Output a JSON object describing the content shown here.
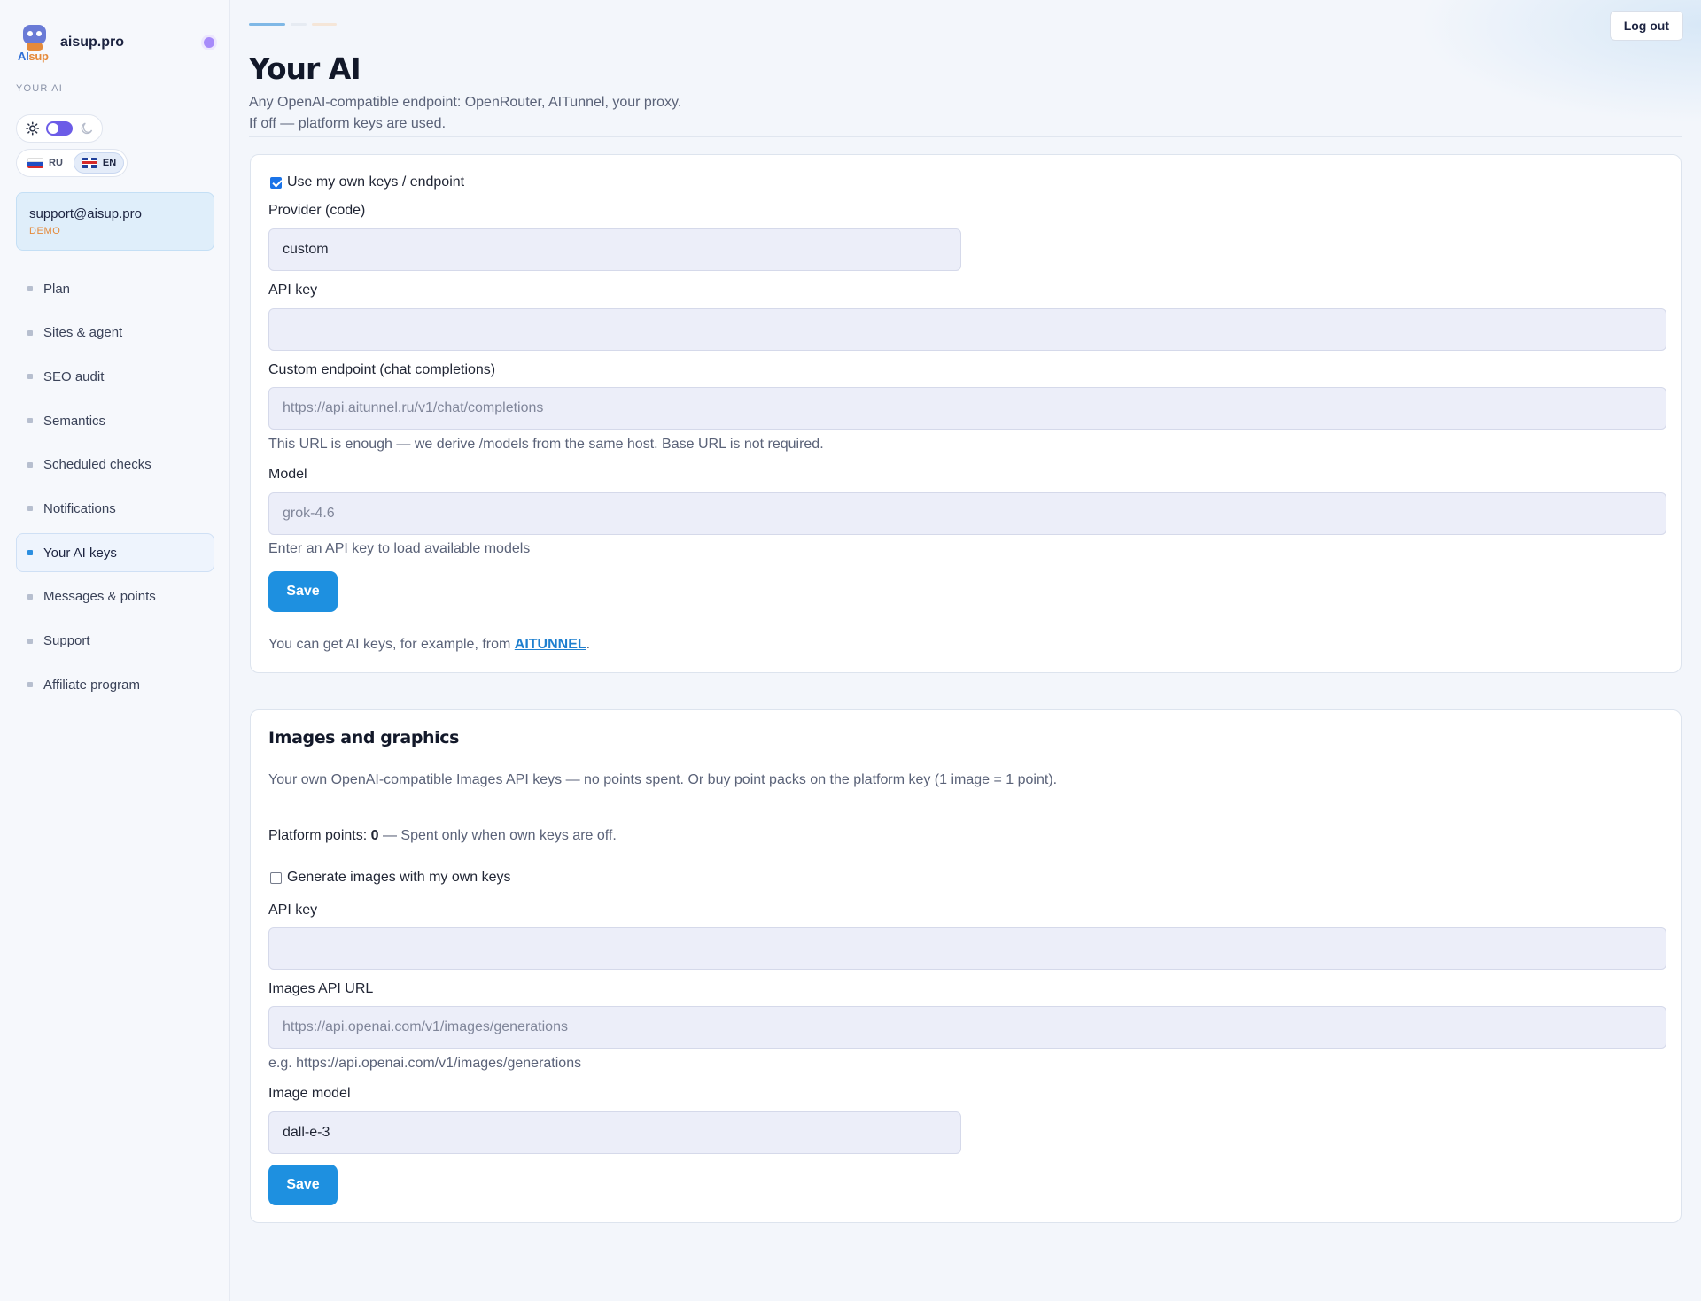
{
  "sidebar": {
    "brand": "aisup.pro",
    "logo_word_a": "AI",
    "logo_word_b": "sup",
    "section_label": "YOUR AI",
    "lang_ru": "RU",
    "lang_en": "EN",
    "account_email": "support@aisup.pro",
    "account_badge": "DEMO",
    "items": [
      {
        "label": "Plan"
      },
      {
        "label": "Sites & agent"
      },
      {
        "label": "SEO audit"
      },
      {
        "label": "Semantics"
      },
      {
        "label": "Scheduled checks"
      },
      {
        "label": "Notifications"
      },
      {
        "label": "Your AI keys",
        "active": true
      },
      {
        "label": "Messages & points"
      },
      {
        "label": "Support"
      },
      {
        "label": "Affiliate program"
      }
    ]
  },
  "header": {
    "logout_label": "Log out",
    "title": "Your AI",
    "subtitle_line1": "Any OpenAI-compatible endpoint: OpenRouter, AITunnel, your proxy.",
    "subtitle_line2": "If off — platform keys are used."
  },
  "own_keys": {
    "checkbox_label": "Use my own keys / endpoint",
    "checkbox_checked": true,
    "provider_label": "Provider (code)",
    "provider_value": "custom",
    "api_key_label": "API key",
    "api_key_value": "",
    "endpoint_label": "Custom endpoint (chat completions)",
    "endpoint_placeholder": "https://api.aitunnel.ru/v1/chat/completions",
    "endpoint_hint": "This URL is enough — we derive /models from the same host. Base URL is not required.",
    "model_label": "Model",
    "model_placeholder": "grok-4.6",
    "model_hint": "Enter an API key to load available models",
    "save_label": "Save",
    "note_prefix": "You can get AI keys, for example, from ",
    "note_link": "AITUNNEL",
    "note_suffix": "."
  },
  "images": {
    "title": "Images and graphics",
    "description": "Your own OpenAI-compatible Images API keys — no points spent. Or buy point packs on the platform key (1 image = 1 point).",
    "points_label": "Platform points: ",
    "points_value": "0",
    "points_note": " — Spent only when own keys are off.",
    "checkbox_label": "Generate images with my own keys",
    "checkbox_checked": false,
    "api_key_label": "API key",
    "api_key_value": "",
    "url_label": "Images API URL",
    "url_placeholder": "https://api.openai.com/v1/images/generations",
    "url_hint": "e.g. https://api.openai.com/v1/images/generations",
    "model_label": "Image model",
    "model_value": "dall-e-3",
    "save_label": "Save"
  },
  "colors": {
    "accent": "#1e90e0",
    "active_nav": "#2b8ee0",
    "demo_badge": "#e58a3a",
    "toggle": "#6c5ce7"
  }
}
